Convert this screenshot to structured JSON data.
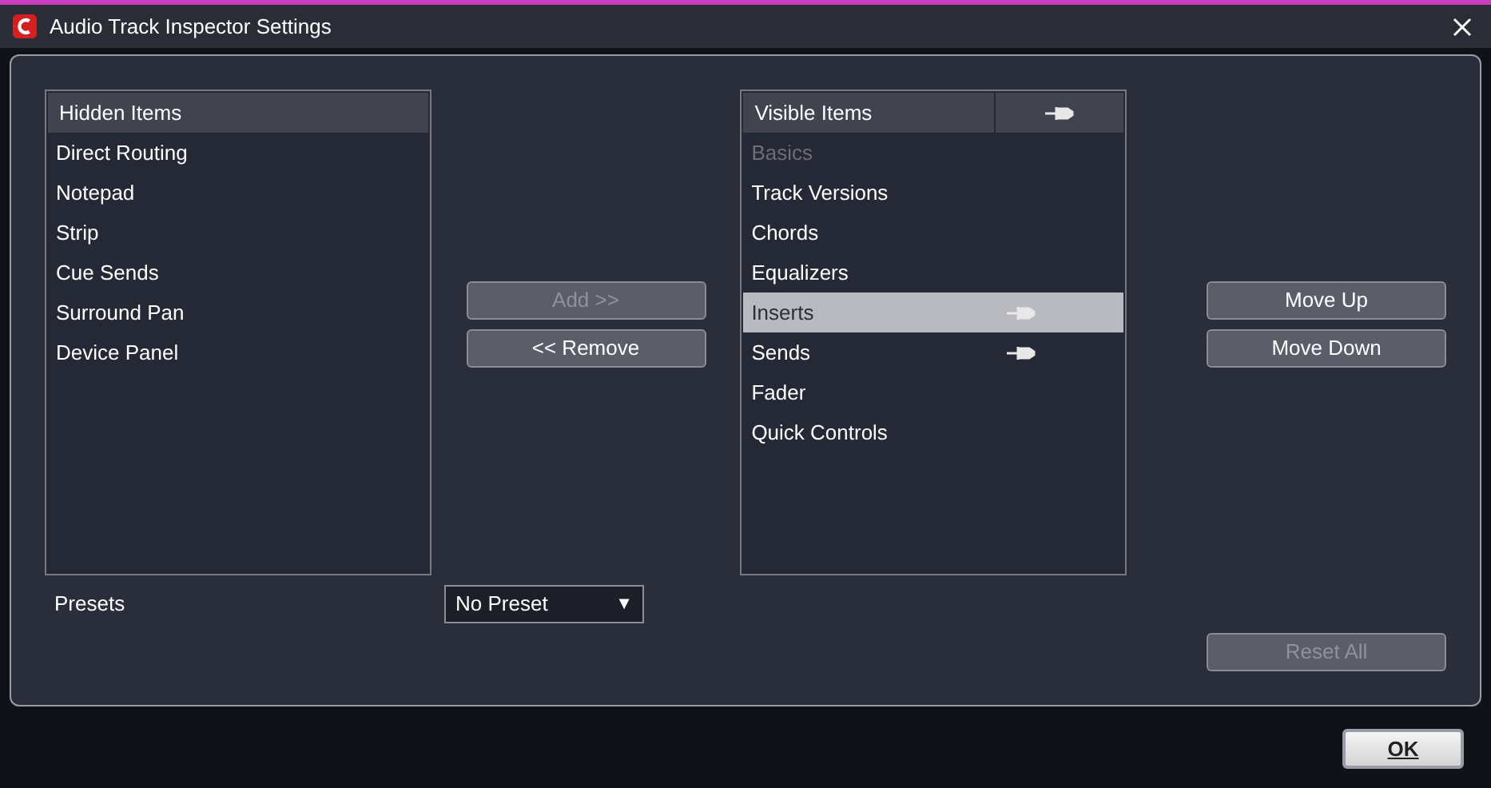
{
  "window": {
    "title": "Audio Track Inspector Settings"
  },
  "hidden_list": {
    "header": "Hidden Items",
    "items": [
      {
        "label": "Direct Routing",
        "selected": false
      },
      {
        "label": "Notepad",
        "selected": false
      },
      {
        "label": "Strip",
        "selected": false
      },
      {
        "label": "Cue Sends",
        "selected": false
      },
      {
        "label": "Surround Pan",
        "selected": false
      },
      {
        "label": "Device Panel",
        "selected": false
      }
    ]
  },
  "transfer_buttons": [
    {
      "label": "Add >>",
      "disabled": true
    },
    {
      "label": "<< Remove",
      "disabled": false
    }
  ],
  "visible_list": {
    "header": "Visible Items",
    "items": [
      {
        "label": "Basics",
        "disabled": true,
        "selected": false,
        "pinned": false
      },
      {
        "label": "Track Versions",
        "disabled": false,
        "selected": false,
        "pinned": false
      },
      {
        "label": "Chords",
        "disabled": false,
        "selected": false,
        "pinned": false
      },
      {
        "label": "Equalizers",
        "disabled": false,
        "selected": false,
        "pinned": false
      },
      {
        "label": "Inserts",
        "disabled": false,
        "selected": true,
        "pinned": true
      },
      {
        "label": "Sends",
        "disabled": false,
        "selected": false,
        "pinned": true
      },
      {
        "label": "Fader",
        "disabled": false,
        "selected": false,
        "pinned": false
      },
      {
        "label": "Quick Controls",
        "disabled": false,
        "selected": false,
        "pinned": false
      }
    ]
  },
  "order_buttons": [
    {
      "label": "Move Up",
      "disabled": false
    },
    {
      "label": "Move Down",
      "disabled": false
    }
  ],
  "presets": {
    "label": "Presets",
    "value": "No Preset",
    "arrow": "▼"
  },
  "reset_button": {
    "label": "Reset All",
    "disabled": true
  },
  "ok_button": {
    "label": "OK"
  }
}
